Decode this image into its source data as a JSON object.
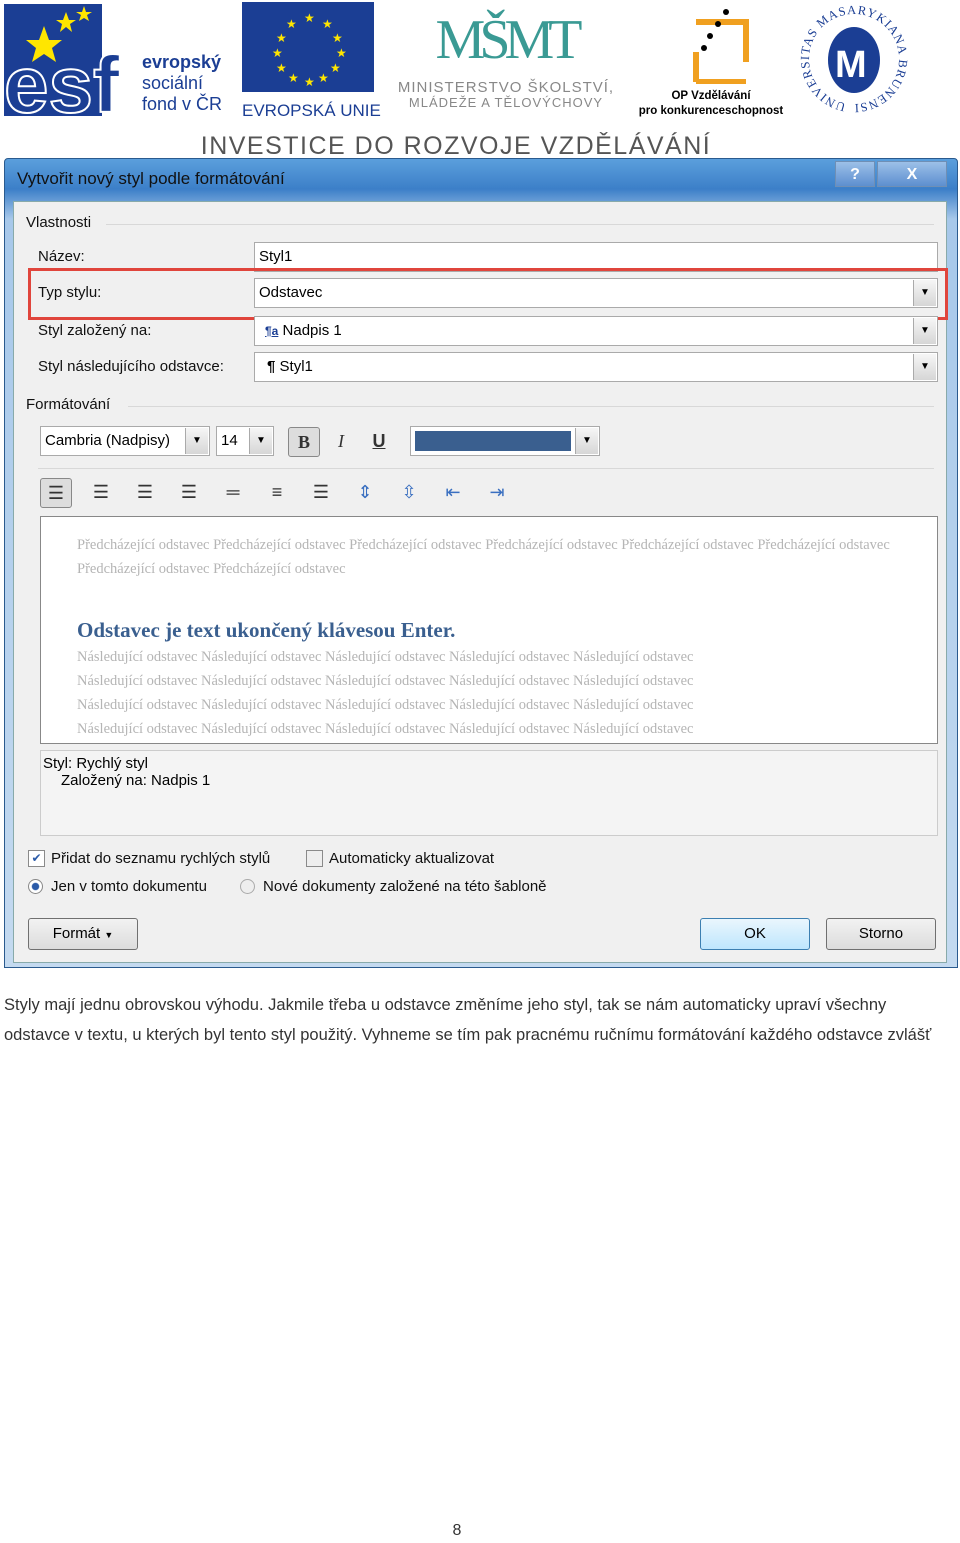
{
  "header": {
    "esf_text": [
      "evropský",
      "sociální",
      "fond v ČR"
    ],
    "eu_text": "EVROPSKÁ UNIE",
    "msmt_text": [
      "MINISTERSTVO ŠKOLSTVÍ,",
      "MLÁDEŽE A TĚLOVÝCHOVY"
    ],
    "op_text": [
      "OP Vzdělávání",
      "pro konkurenceschopnost"
    ],
    "mu_text": "UNIVERSITAS MASARYKIANA BRUNENSIS",
    "tagline": "INVESTICE DO ROZVOJE VZDĚLÁVÁNÍ"
  },
  "dialog": {
    "title": "Vytvořit nový styl podle formátování",
    "help": "?",
    "close": "X",
    "properties_label": "Vlastnosti",
    "name_label": "Název:",
    "name_value": "Styl1",
    "type_label": "Typ stylu:",
    "type_value": "Odstavec",
    "based_label": "Styl založený na:",
    "based_value": "Nadpis 1",
    "next_label": "Styl následujícího odstavce:",
    "next_value": "Styl1",
    "formatting_label": "Formátování",
    "font": "Cambria (Nadpisy)",
    "size": "14",
    "bold": "B",
    "italic": "I",
    "underline": "U",
    "font_color": "#3a5f8f",
    "highlight_color": "#e8403a",
    "preview_prev": "Předcházející odstavec Předcházející odstavec Předcházející odstavec Předcházející odstavec Předcházející odstavec Předcházející odstavec Předcházející odstavec Předcházející odstavec",
    "preview_sample": "Odstavec je text ukončený klávesou Enter.",
    "preview_next": "Následující odstavec Následující odstavec Následující odstavec Následující odstavec Následující odstavec",
    "desc_line1": "Styl: Rychlý styl",
    "desc_line2": "Založený na: Nadpis 1",
    "add_quick": "Přidat do seznamu rychlých stylů",
    "add_quick_checked": true,
    "auto_update": "Automaticky aktualizovat",
    "auto_update_checked": false,
    "only_doc": "Jen v tomto dokumentu",
    "only_doc_selected": true,
    "new_docs": "Nové dokumenty založené na této šabloně",
    "format_btn": "Formát",
    "ok": "OK",
    "cancel": "Storno"
  },
  "body_text": "Styly mají jednu obrovskou výhodu. Jakmile třeba u odstavce změníme jeho styl, tak se nám automaticky upraví všechny odstavce v textu, u kterých byl tento styl použitý. Vyhneme se tím pak pracnému ručnímu formátování každého odstavce zvlášť",
  "page_number": "8"
}
